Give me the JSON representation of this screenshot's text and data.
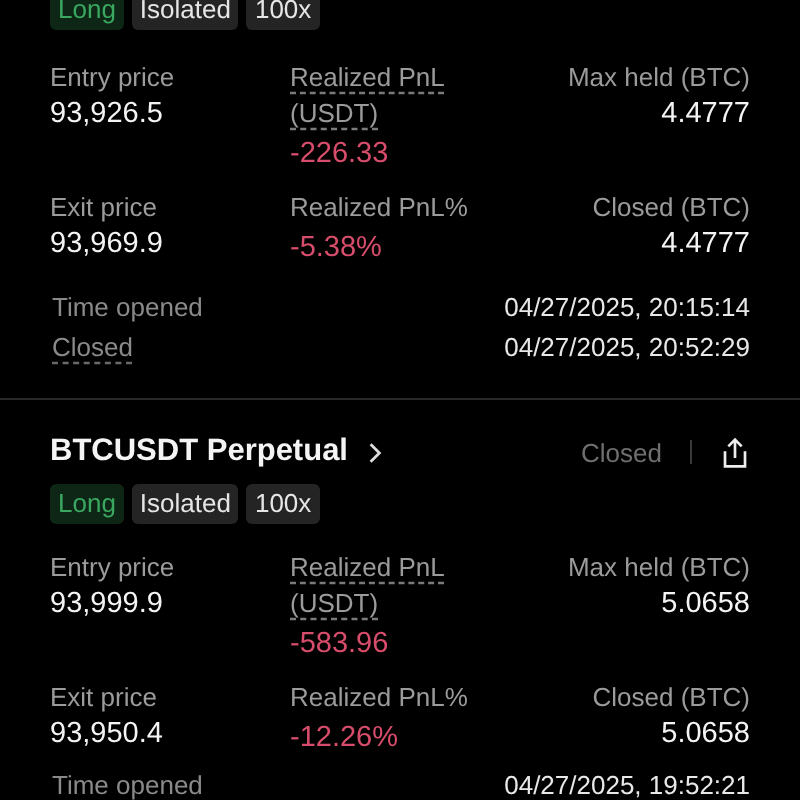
{
  "positions": [
    {
      "tags": [
        {
          "label": "Long",
          "kind": "long"
        },
        {
          "label": "Isolated",
          "kind": "plain"
        },
        {
          "label": "100x",
          "kind": "plain"
        }
      ],
      "stats": [
        {
          "label": "Entry price",
          "value": "93,926.5",
          "kind": "plain",
          "dotted": false
        },
        {
          "label": "Realized PnL (USDT)",
          "value": "-226.33",
          "kind": "loss",
          "dotted": true
        },
        {
          "label": "Max held (BTC)",
          "value": "4.4777",
          "kind": "plain",
          "dotted": false
        },
        {
          "label": "Exit price",
          "value": "93,969.9",
          "kind": "plain",
          "dotted": false
        },
        {
          "label": "Realized PnL%",
          "value": "-5.38%",
          "kind": "loss",
          "dotted": false
        },
        {
          "label": "Closed (BTC)",
          "value": "4.4777",
          "kind": "plain",
          "dotted": false
        }
      ],
      "times": [
        {
          "label": "Time opened",
          "value": "04/27/2025, 20:15:14",
          "dotted": false
        },
        {
          "label": "Closed",
          "value": "04/27/2025, 20:52:29",
          "dotted": true
        }
      ]
    },
    {
      "title": "BTCUSDT Perpetual",
      "status": "Closed",
      "tags": [
        {
          "label": "Long",
          "kind": "long"
        },
        {
          "label": "Isolated",
          "kind": "plain"
        },
        {
          "label": "100x",
          "kind": "plain"
        }
      ],
      "stats": [
        {
          "label": "Entry price",
          "value": "93,999.9",
          "kind": "plain",
          "dotted": false
        },
        {
          "label": "Realized PnL (USDT)",
          "value": "-583.96",
          "kind": "loss",
          "dotted": true
        },
        {
          "label": "Max held (BTC)",
          "value": "5.0658",
          "kind": "plain",
          "dotted": false
        },
        {
          "label": "Exit price",
          "value": "93,950.4",
          "kind": "plain",
          "dotted": false
        },
        {
          "label": "Realized PnL%",
          "value": "-12.26%",
          "kind": "loss",
          "dotted": false
        },
        {
          "label": "Closed (BTC)",
          "value": "5.0658",
          "kind": "plain",
          "dotted": false
        }
      ],
      "times": [
        {
          "label": "Time opened",
          "value": "04/27/2025, 19:52:21",
          "dotted": false
        }
      ]
    }
  ]
}
